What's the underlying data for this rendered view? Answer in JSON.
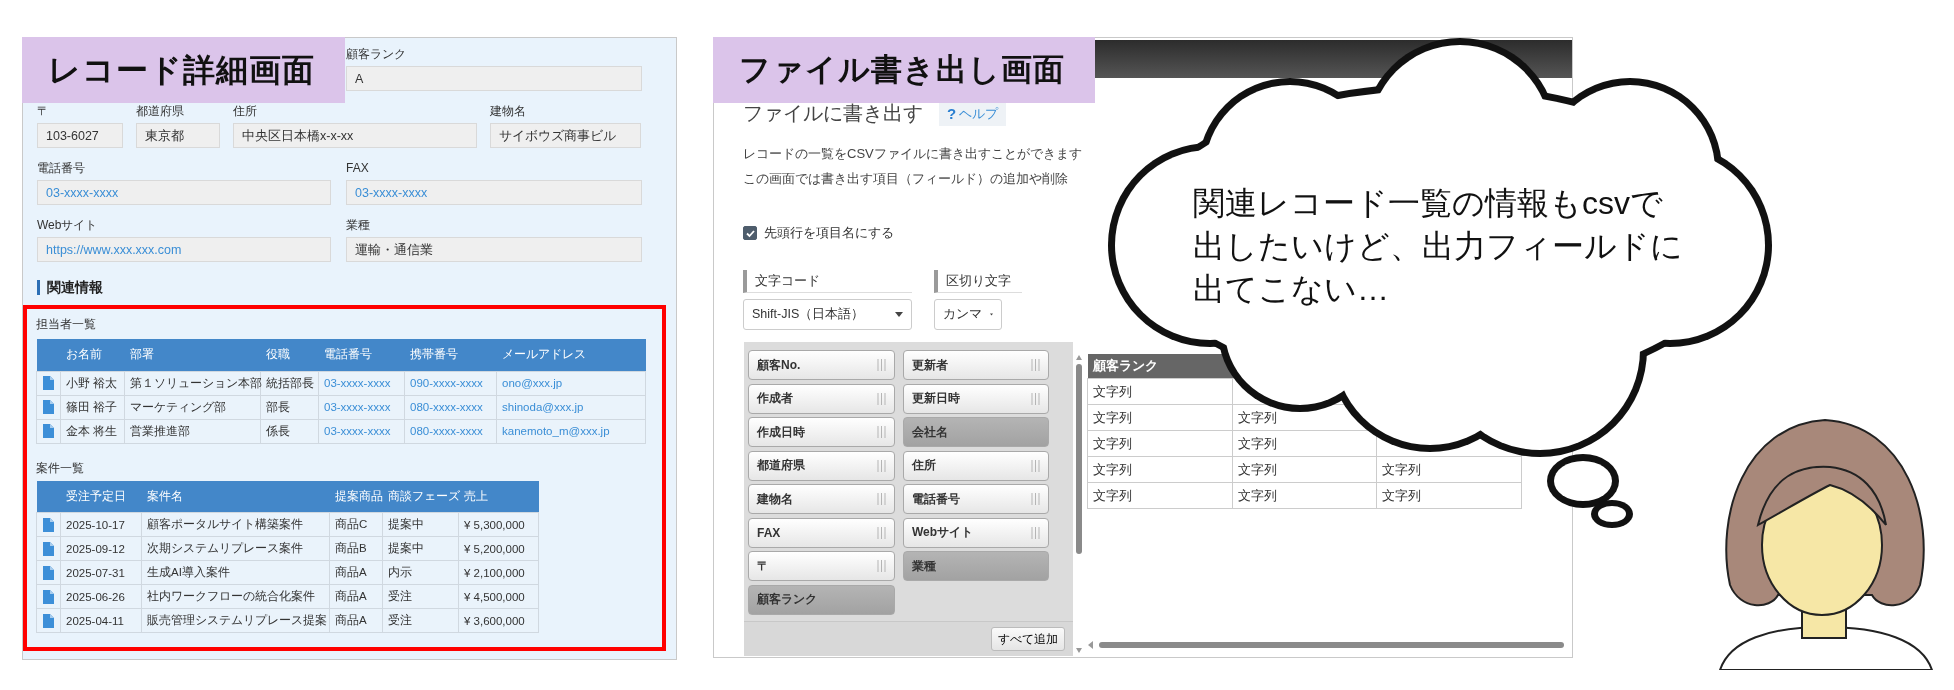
{
  "record_screen": {
    "label": "レコード詳細画面",
    "field_rows": [
      {
        "fields": [
          {
            "label": "顧客ランク",
            "value": "A",
            "link": false
          }
        ]
      },
      {
        "fields": [
          {
            "label": "〒",
            "value": "103-6027",
            "link": false
          },
          {
            "label": "都道府県",
            "value": "東京都",
            "link": false
          },
          {
            "label": "住所",
            "value": "中央区日本橋x-x-xx",
            "link": false
          },
          {
            "label": "建物名",
            "value": "サイボウズ商事ビル",
            "link": false
          }
        ]
      },
      {
        "fields": [
          {
            "label": "電話番号",
            "value": "03-xxxx-xxxx",
            "link": true
          },
          {
            "label": "FAX",
            "value": "03-xxxx-xxxx",
            "link": true
          }
        ]
      },
      {
        "fields": [
          {
            "label": "Webサイト",
            "value": "https://www.xxx.xxx.com",
            "link": true
          },
          {
            "label": "業種",
            "value": "運輸・通信業",
            "link": false
          }
        ]
      }
    ],
    "section_heading": "関連情報",
    "related_tables": [
      {
        "title": "担当者一覧",
        "columns": [
          {
            "label": "お名前",
            "link": false
          },
          {
            "label": "部署",
            "link": false
          },
          {
            "label": "役職",
            "link": false
          },
          {
            "label": "電話番号",
            "link": true
          },
          {
            "label": "携帯番号",
            "link": true
          },
          {
            "label": "メールアドレス",
            "link": true
          }
        ],
        "rows": [
          {
            "cells": [
              "小野 裕太",
              "第１ソリューション本部",
              "統括部長",
              "03-xxxx-xxxx",
              "090-xxxx-xxxx",
              "ono@xxx.jp"
            ]
          },
          {
            "cells": [
              "篠田 裕子",
              "マーケティング部",
              "部長",
              "03-xxxx-xxxx",
              "080-xxxx-xxxx",
              "shinoda@xxx.jp"
            ]
          },
          {
            "cells": [
              "金本 将生",
              "営業推進部",
              "係長",
              "03-xxxx-xxxx",
              "080-xxxx-xxxx",
              "kanemoto_m@xxx.jp"
            ]
          }
        ]
      },
      {
        "title": "案件一覧",
        "columns": [
          {
            "label": "受注予定日",
            "link": false
          },
          {
            "label": "案件名",
            "link": false
          },
          {
            "label": "提案商品",
            "link": false
          },
          {
            "label": "商談フェーズ",
            "link": false
          },
          {
            "label": "売上",
            "link": false
          }
        ],
        "rows": [
          {
            "cells": [
              "2025-10-17",
              "顧客ポータルサイト構築案件",
              "商品C",
              "提案中",
              "¥ 5,300,000"
            ]
          },
          {
            "cells": [
              "2025-09-12",
              "次期システムリプレース案件",
              "商品B",
              "提案中",
              "¥ 5,200,000"
            ]
          },
          {
            "cells": [
              "2025-07-31",
              "生成AI導入案件",
              "商品A",
              "内示",
              "¥ 2,100,000"
            ]
          },
          {
            "cells": [
              "2025-06-26",
              "社内ワークフローの統合化案件",
              "商品A",
              "受注",
              "¥ 4,500,000"
            ]
          },
          {
            "cells": [
              "2025-04-11",
              "販売管理システムリプレース提案",
              "商品A",
              "受注",
              "¥ 3,600,000"
            ]
          }
        ]
      }
    ]
  },
  "export_screen": {
    "label": "ファイル書き出し画面",
    "heading": "ファイルに書き出す",
    "help_button": {
      "mark": "?",
      "label": "ヘルプ"
    },
    "description": [
      "レコードの一覧をCSVファイルに書き出すことができます",
      "この画面では書き出す項目（フィールド）の追加や削除"
    ],
    "header_checkbox": {
      "label": "先頭行を項目名にする",
      "checked": true
    },
    "selects": [
      {
        "label": "文字コード",
        "value": "Shift-JIS（日本語）"
      },
      {
        "label": "区切り文字",
        "value": "カンマ"
      }
    ],
    "field_picker": {
      "fields": [
        {
          "label": "顧客No.",
          "added": false
        },
        {
          "label": "更新者",
          "added": false
        },
        {
          "label": "作成者",
          "added": false
        },
        {
          "label": "更新日時",
          "added": false
        },
        {
          "label": "作成日時",
          "added": false
        },
        {
          "label": "会社名",
          "added": true
        },
        {
          "label": "都道府県",
          "added": false
        },
        {
          "label": "住所",
          "added": false
        },
        {
          "label": "建物名",
          "added": false
        },
        {
          "label": "電話番号",
          "added": false
        },
        {
          "label": "FAX",
          "added": false
        },
        {
          "label": "Webサイト",
          "added": false
        },
        {
          "label": "〒",
          "added": false
        },
        {
          "label": "業種",
          "added": true
        },
        {
          "label": "顧客ランク",
          "added": true
        }
      ],
      "add_all_button": "すべて追加"
    },
    "preview": {
      "columns": [
        "顧客ランク"
      ],
      "rows": [
        [
          "文字列"
        ],
        [
          "文字列",
          "文字列"
        ],
        [
          "文字列",
          "文字列"
        ],
        [
          "文字列",
          "文字列",
          "文字列"
        ],
        [
          "文字列",
          "文字列",
          "文字列"
        ]
      ]
    }
  },
  "thought_bubble": {
    "text": "関連レコード一覧の情報もcsvで出したいけど、出力フィールドに出てこない…"
  }
}
